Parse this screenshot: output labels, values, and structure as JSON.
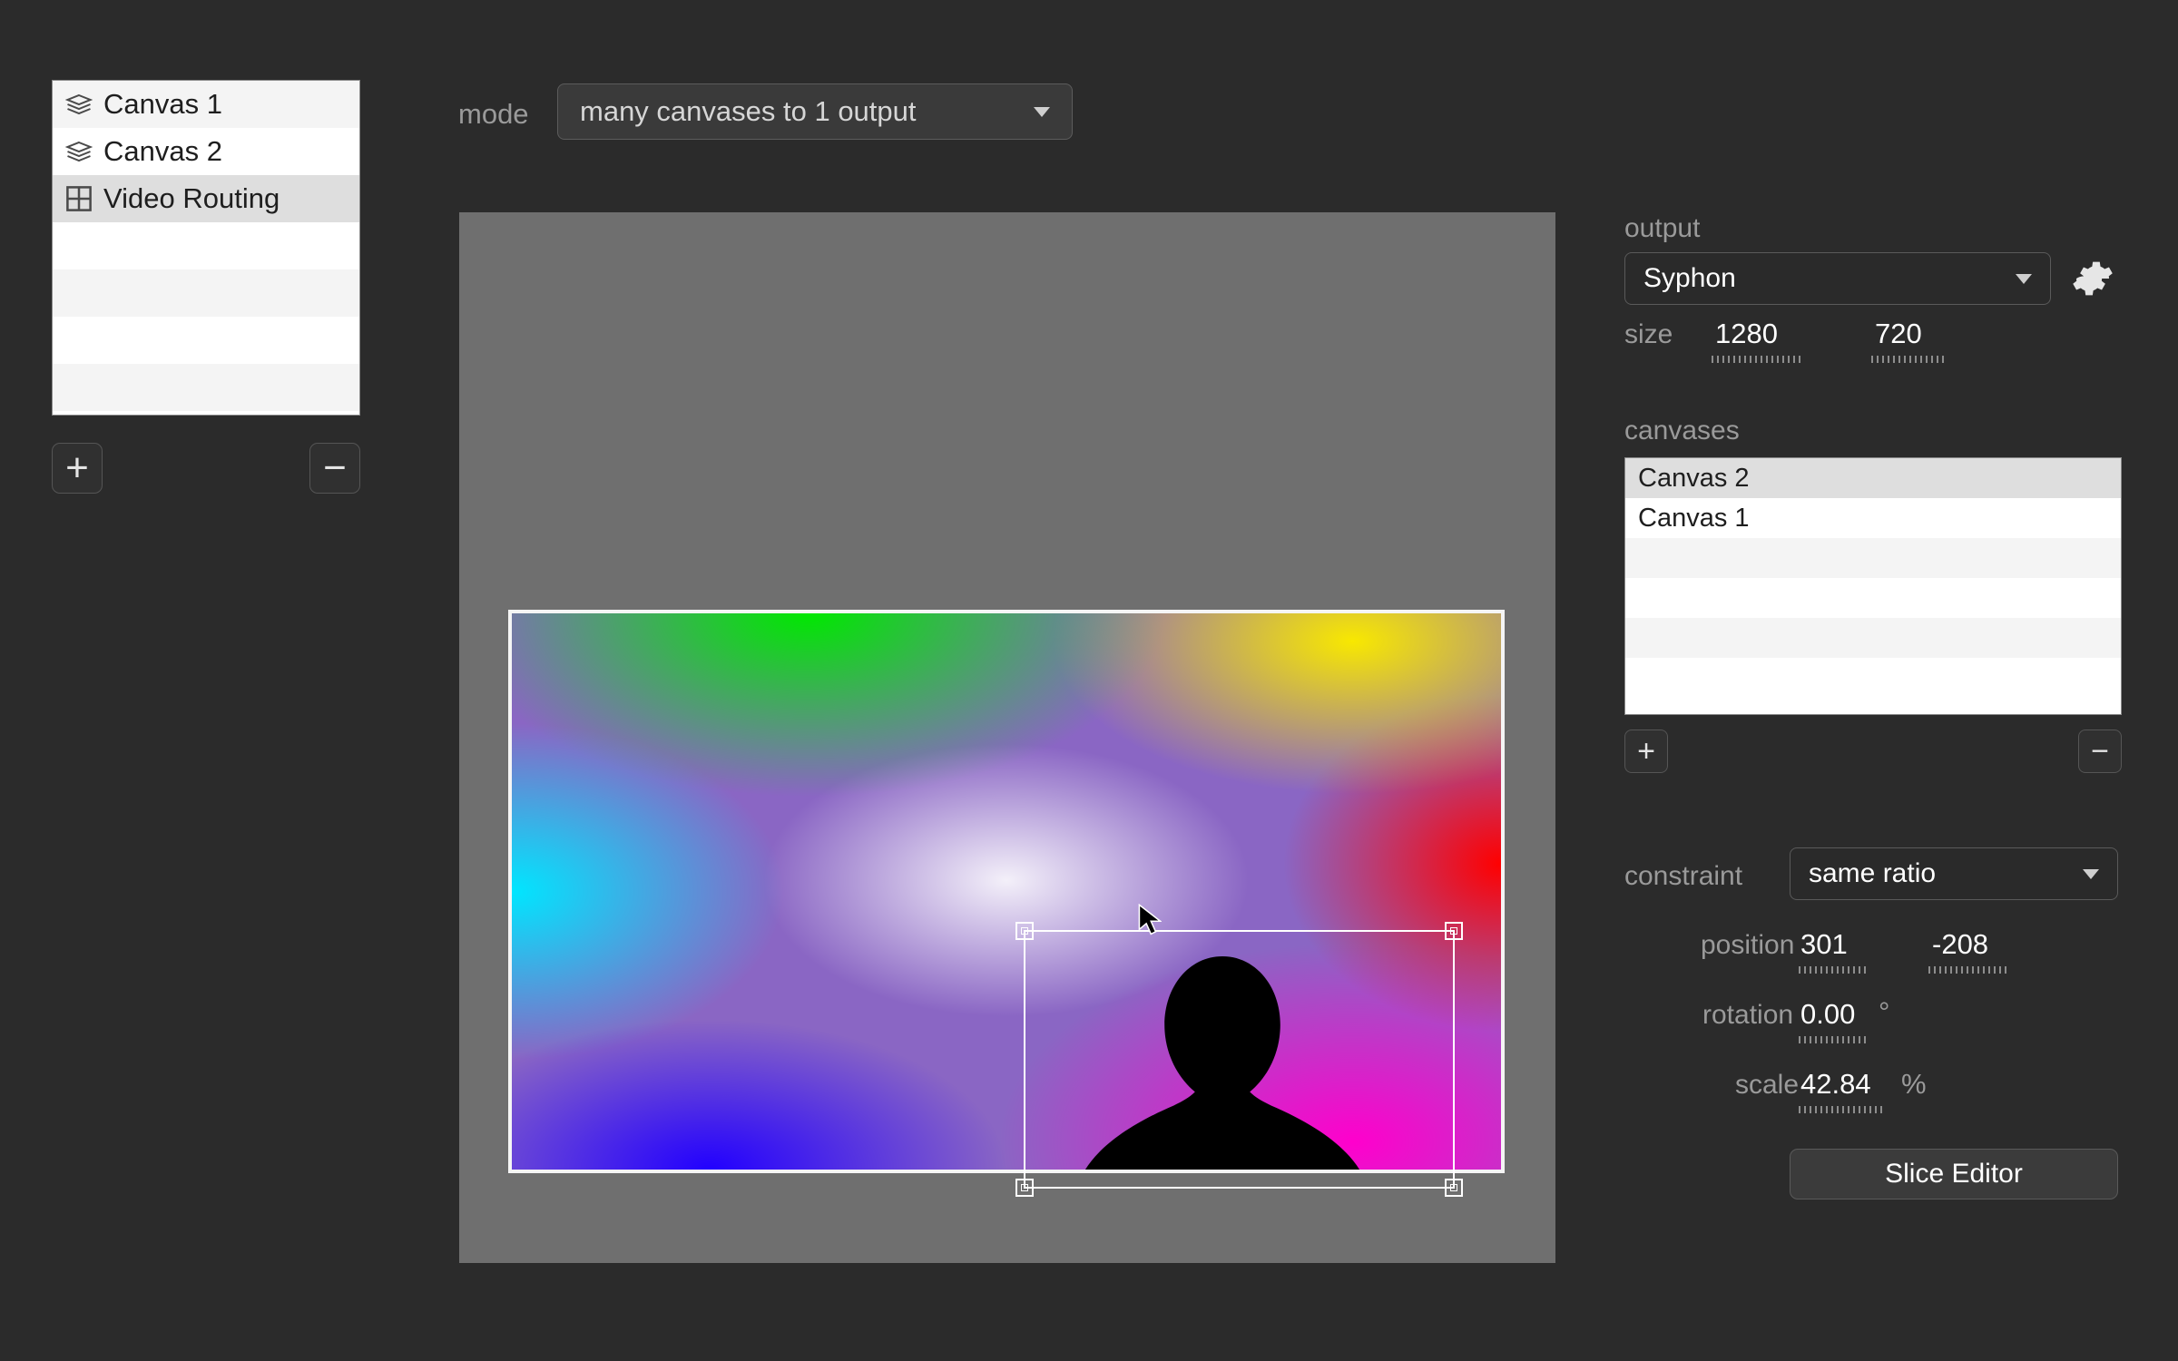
{
  "mode": {
    "label": "mode",
    "value": "many canvases to 1 output"
  },
  "leftList": {
    "items": [
      {
        "label": "Canvas 1",
        "icon": "layers",
        "selected": false
      },
      {
        "label": "Canvas 2",
        "icon": "layers",
        "selected": false
      },
      {
        "label": "Video Routing",
        "icon": "grid",
        "selected": true
      }
    ],
    "addGlyph": "+",
    "removeGlyph": "−"
  },
  "output": {
    "label": "output",
    "destination": "Syphon",
    "sizeLabel": "size",
    "width": "1280",
    "height": "720"
  },
  "canvases": {
    "label": "canvases",
    "items": [
      {
        "label": "Canvas 2",
        "selected": true
      },
      {
        "label": "Canvas 1",
        "selected": false
      }
    ],
    "addGlyph": "+",
    "removeGlyph": "−"
  },
  "constraint": {
    "label": "constraint",
    "value": "same ratio"
  },
  "position": {
    "label": "position",
    "x": "301",
    "y": "-208"
  },
  "rotation": {
    "label": "rotation",
    "value": "0.00",
    "unit": "°"
  },
  "scale": {
    "label": "scale",
    "value": "42.84",
    "unit": "%"
  },
  "sliceEditor": {
    "label": "Slice Editor"
  },
  "selection": {
    "xGlyph": "×"
  }
}
